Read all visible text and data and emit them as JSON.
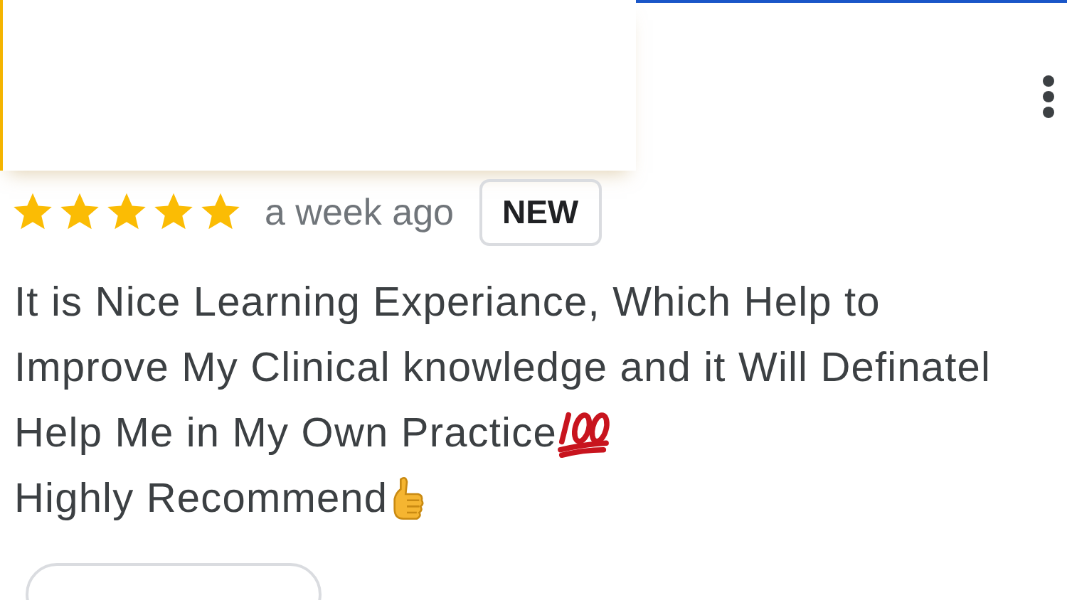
{
  "review": {
    "stars": 5,
    "time": "a week ago",
    "badge": "NEW",
    "lines": [
      {
        "kind": "plain",
        "text": "It is Nice Learning Experiance, Which Help to"
      },
      {
        "kind": "plain",
        "text": "Improve My Clinical knowledge and it Will Definatel"
      },
      {
        "kind": "hundred",
        "text": "Help Me in My Own Practice"
      },
      {
        "kind": "thumbs",
        "text": "Highly Recommend"
      }
    ]
  }
}
